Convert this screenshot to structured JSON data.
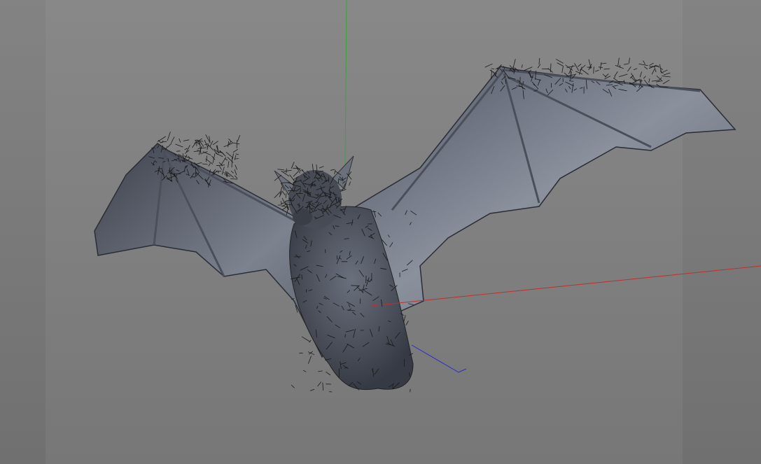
{
  "viewport": {
    "background_color": "#7c7c7c",
    "render_frame_color": "#868686",
    "model": "bat",
    "model_color": "#5c6270",
    "axes": {
      "x_color": "#c0302a",
      "y_color": "#3aa53a",
      "z_color": "#2a2ad0"
    }
  }
}
